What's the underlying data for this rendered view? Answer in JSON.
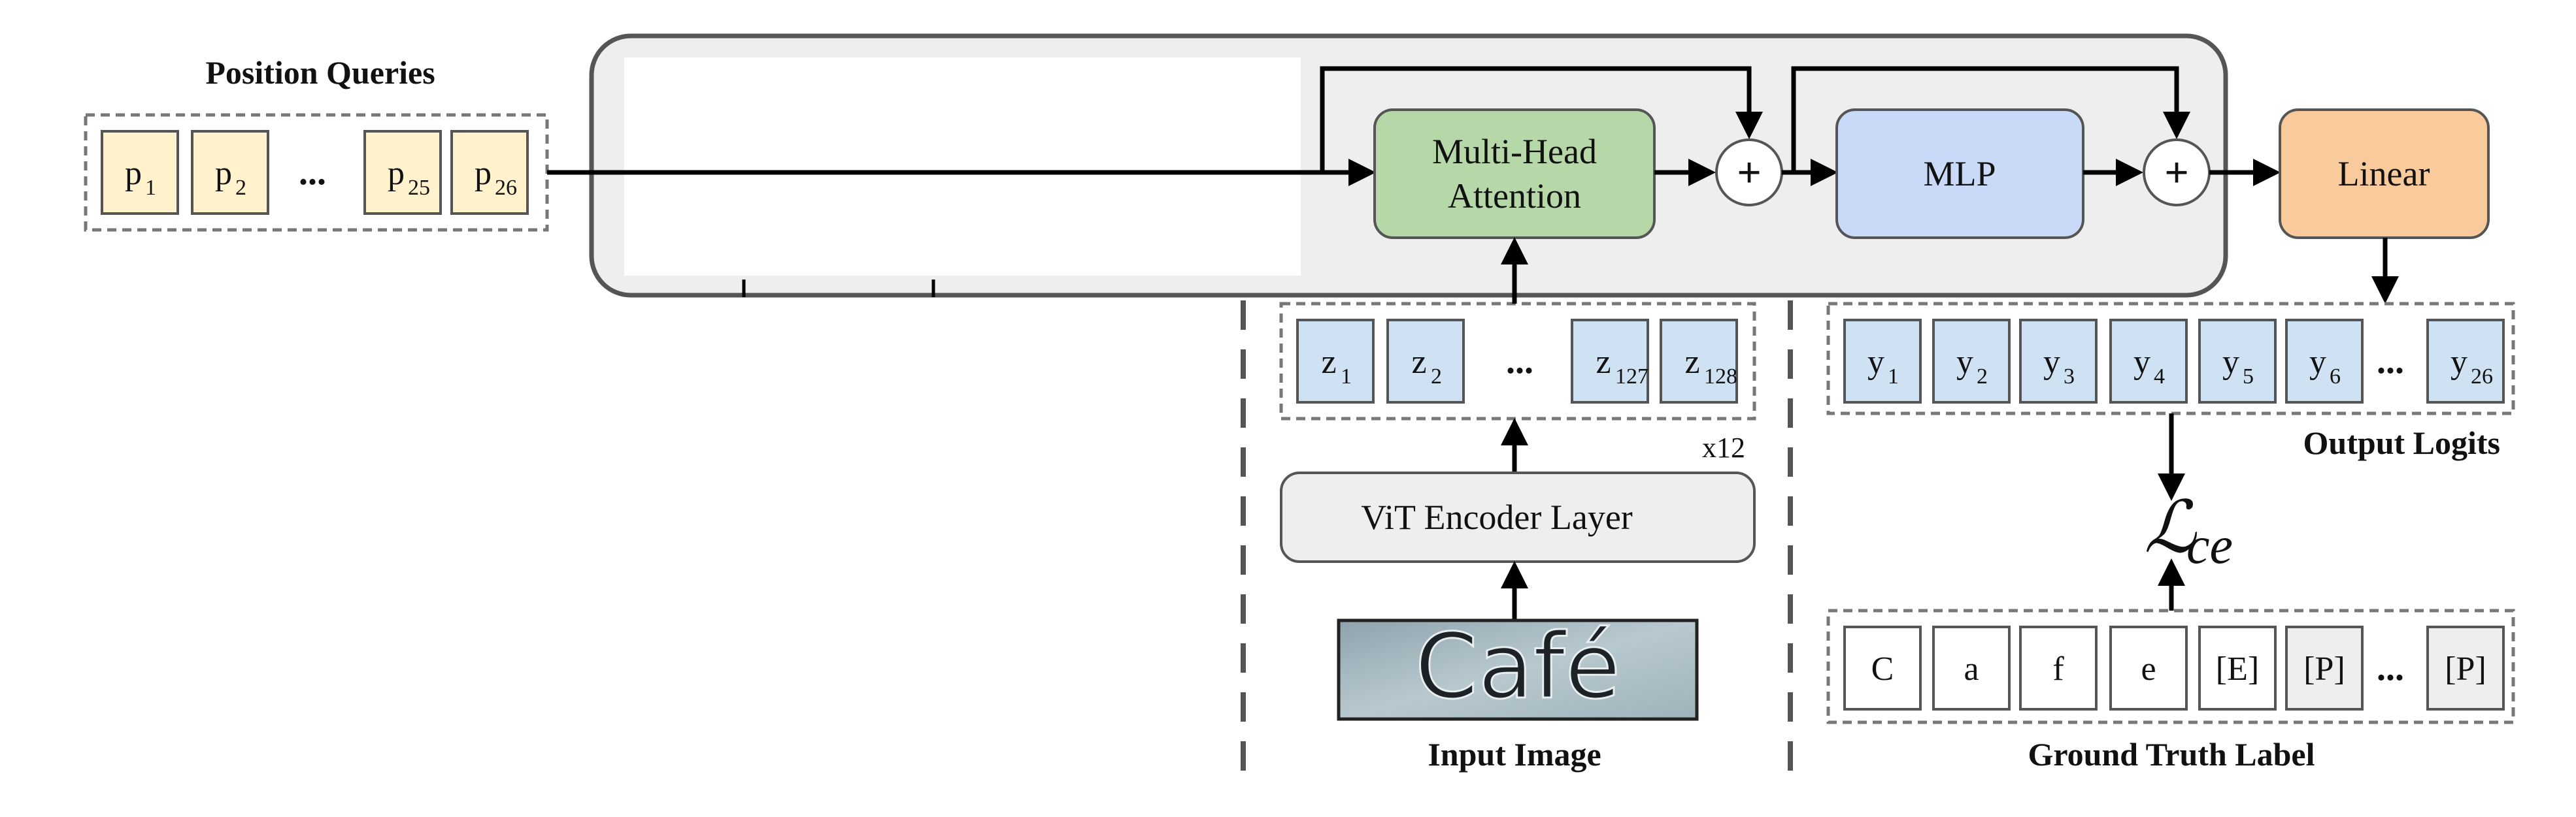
{
  "position_queries": {
    "title": "Position Queries",
    "tokens": [
      "p",
      "p",
      "p",
      "p"
    ],
    "subs": [
      "1",
      "2",
      "25",
      "26"
    ],
    "ellipsis": "..."
  },
  "decoder": {
    "attention": [
      "Multi-Head",
      "Attention"
    ],
    "plus": "+",
    "mlp": "MLP",
    "linear": "Linear",
    "colors": {
      "attention": "#b6d7a8",
      "mlp": "#c9daf8",
      "linear": "#f9cb9c",
      "block": "#eeeeee"
    }
  },
  "encoder": {
    "tokens": [
      "z",
      "z",
      "z",
      "z"
    ],
    "subs": [
      "1",
      "2",
      "127",
      "128"
    ],
    "ellipsis": "...",
    "layer": "ViT Encoder Layer",
    "repeat": "x12",
    "image_text": "Café",
    "image_caption": "Input Image"
  },
  "output": {
    "tokens": [
      "y",
      "y",
      "y",
      "y",
      "y",
      "y",
      "y"
    ],
    "subs": [
      "1",
      "2",
      "3",
      "4",
      "5",
      "6",
      "26"
    ],
    "ellipsis": "...",
    "caption": "Output Logits"
  },
  "loss": {
    "symbol": "ℒ",
    "sub": "ce"
  },
  "ground_truth": {
    "tokens": [
      "C",
      "a",
      "f",
      "e",
      "[E]",
      "[P]",
      "[P]"
    ],
    "ellipsis": "...",
    "caption": "Ground Truth Label"
  }
}
